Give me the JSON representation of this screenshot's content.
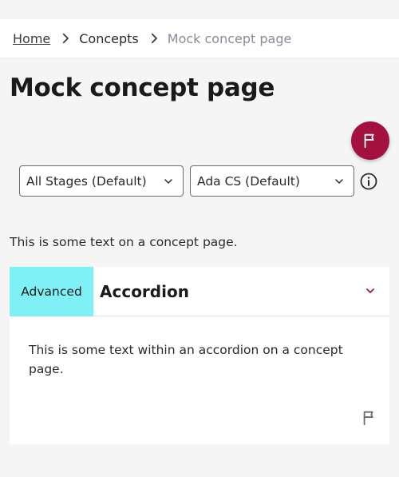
{
  "breadcrumb": {
    "items": [
      {
        "label": "Home"
      },
      {
        "label": "Concepts"
      },
      {
        "label": "Mock concept page"
      }
    ]
  },
  "page": {
    "title": "Mock concept page",
    "intro_text": "This is some text on a concept page."
  },
  "filters": {
    "stage_select": {
      "value": "All Stages (Default)"
    },
    "curriculum_select": {
      "value": "Ada CS (Default)"
    }
  },
  "accordion": {
    "badge": "Advanced",
    "title": "Accordion",
    "body": "This is some text within an accordion on a concept page."
  },
  "colors": {
    "flag_button": "#a3123f",
    "badge_bg": "#7ff0f5",
    "page_bg": "#f5f5f5"
  },
  "icons": {
    "separator": "chevron-right-icon",
    "flag": "flag-icon",
    "select": "chevron-down-icon",
    "info": "info-icon"
  }
}
